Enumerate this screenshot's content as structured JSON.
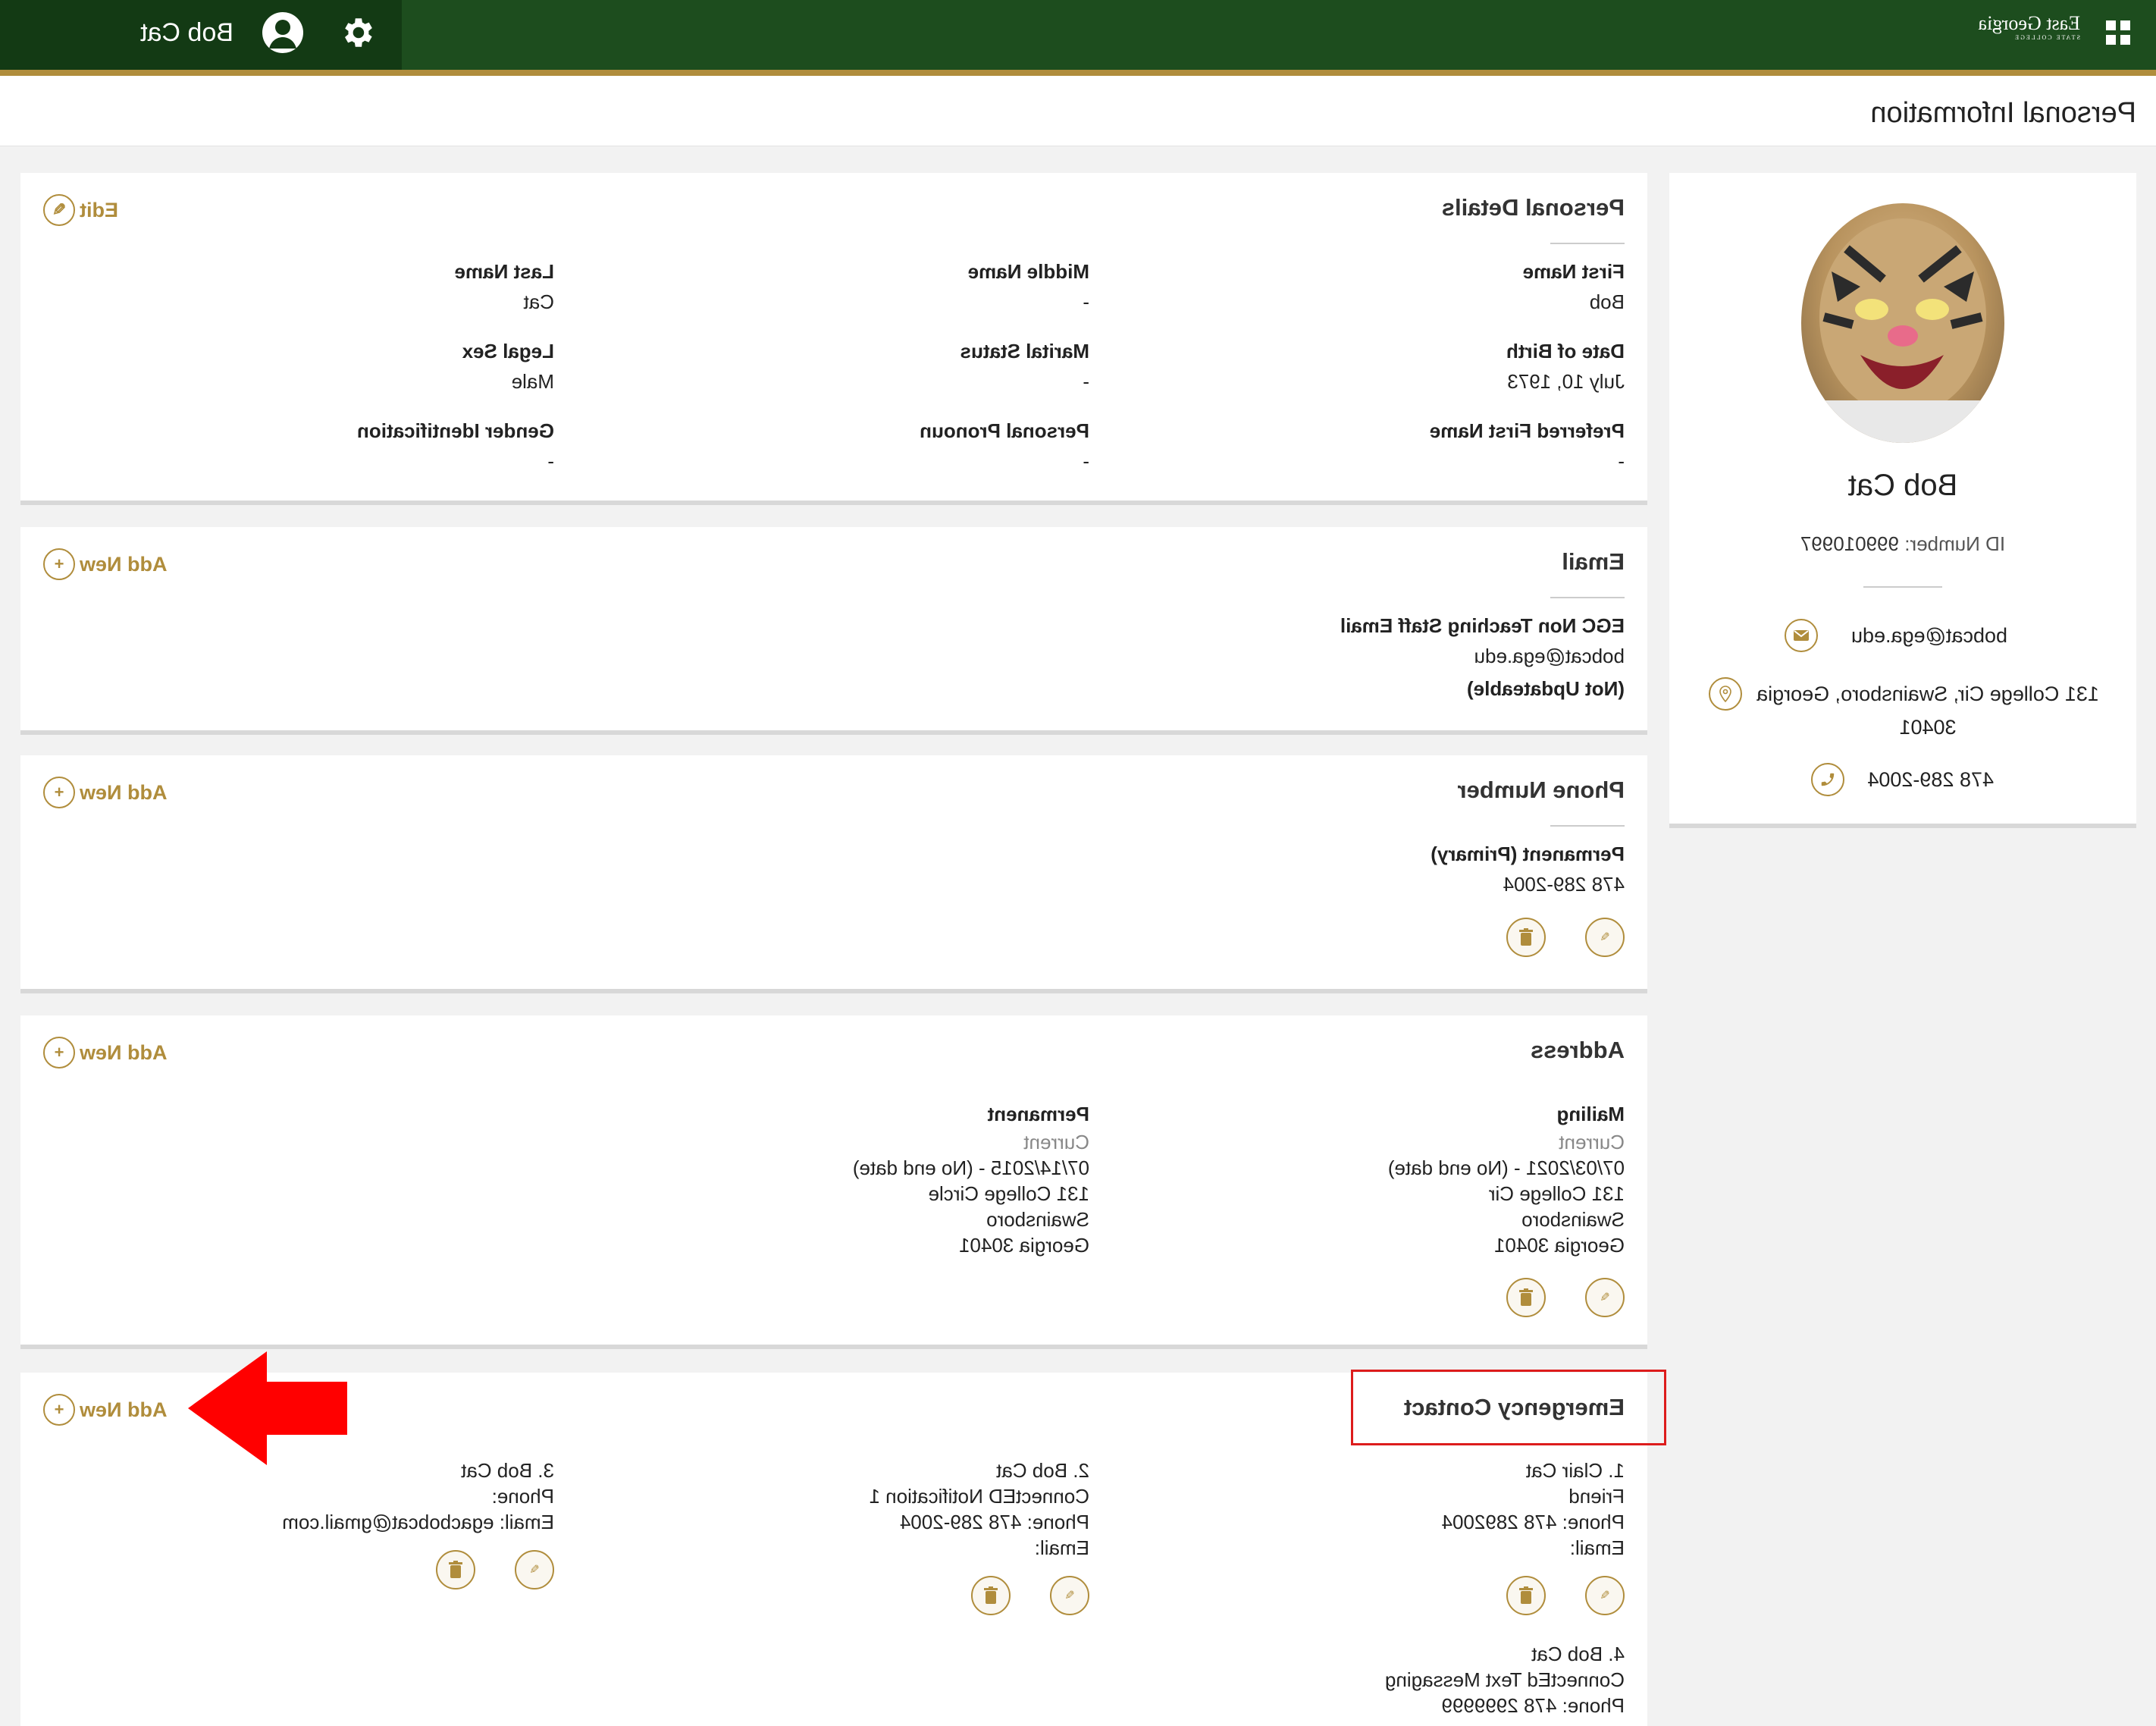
{
  "header": {
    "logo_line1": "East Georgia",
    "logo_line2": "STATE COLLEGE",
    "user_name": "Bob Cat"
  },
  "page": {
    "title": "Personal Information"
  },
  "profile": {
    "name": "Bob Cat",
    "id_label": "ID Number:",
    "id_value": "999010997",
    "email": "bobcat@ega.edu",
    "address_line1": "131 College Cir, Swainsboro, Georgia",
    "address_line2": "30401",
    "phone": "478 289-2004"
  },
  "personal_details": {
    "title": "Personal Details",
    "edit_label": "Edit",
    "fields": [
      {
        "label": "First Name",
        "value": "Bob"
      },
      {
        "label": "Middle Name",
        "value": "-"
      },
      {
        "label": "Last Name",
        "value": "Cat"
      },
      {
        "label": "Date of Birth",
        "value": "July 10, 1973"
      },
      {
        "label": "Marital Status",
        "value": "-"
      },
      {
        "label": "Legal Sex",
        "value": "Male"
      },
      {
        "label": "Preferred First Name",
        "value": "-"
      },
      {
        "label": "Personal Pronoun",
        "value": "-"
      },
      {
        "label": "Gender Identification",
        "value": "-"
      }
    ]
  },
  "email_section": {
    "title": "Email",
    "add_label": "Add New",
    "type": "EGC Non Teaching Staff Email",
    "address": "bobcat@ega.edu",
    "note": "(Not Updateable)"
  },
  "phone_section": {
    "title": "Phone Number",
    "add_label": "Add New",
    "type": "Permanent (Primary)",
    "number": "478 289-2004"
  },
  "address_section": {
    "title": "Address",
    "add_label": "Add New",
    "addresses": [
      {
        "type": "Mailing",
        "status": "Current",
        "dates": "07/03/2021 - (No end date)",
        "street": "131 College Cir",
        "city": "Swainsboro",
        "state_zip": "Georgia 30401"
      },
      {
        "type": "Permanent",
        "status": "Current",
        "dates": "07/14/2015 - (No end date)",
        "street": "131 College Circle",
        "city": "Swainsboro",
        "state_zip": "Georgia 30401"
      }
    ]
  },
  "emergency_section": {
    "title": "Emergency Contact",
    "add_label": "Add New",
    "contacts": [
      {
        "name": "1. Clair Cat",
        "line2": "Friend",
        "phone": "Phone: 478 2892004",
        "email": "Email:"
      },
      {
        "name": "2. Bob Cat",
        "line2": "ConnectED Notification 1",
        "phone": "Phone: 478 289-2004",
        "email": "Email:"
      },
      {
        "name": "3. Bob Cat",
        "line2": "Phone:",
        "phone": "Email: egacbobcat@gmail.com",
        "email": ""
      },
      {
        "name": "4. Bob Cat",
        "line2": "ConnectEd Text Messaging",
        "phone": "Phone: 478 2999999",
        "email": ""
      }
    ]
  },
  "colors": {
    "header_green": "#1d4d1e",
    "gold": "#b08d3c",
    "highlight_red": "#dd1c1c"
  }
}
